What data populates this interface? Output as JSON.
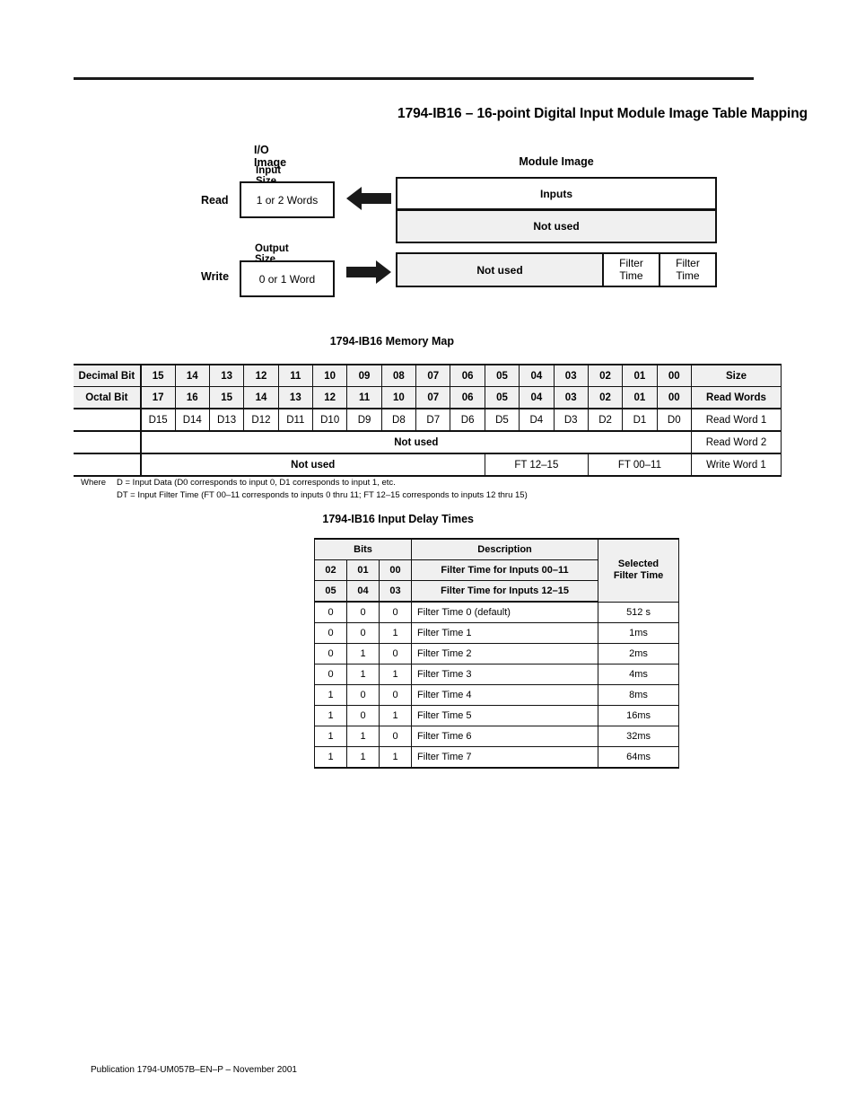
{
  "page": {
    "title": "1794-IB16 – 16-point Digital Input Module Image Table Mapping",
    "footer": "Publication 1794-UM057B–EN–P – November 2001"
  },
  "diagram": {
    "io_image_label": "I/O Image",
    "input_size_label": "Input Size",
    "output_size_label": "Output Size",
    "module_image_label": "Module Image",
    "read_label": "Read",
    "write_label": "Write",
    "input_size_value": "1 or 2 Words",
    "output_size_value": "0 or 1 Word",
    "read_arrow_icon": "arrow-left-icon",
    "write_arrow_icon": "arrow-right-icon",
    "module_inputs": "Inputs",
    "module_not_used_read": "Not used",
    "module_not_used_write": "Not used",
    "module_filter_time_1": "Filter\nTime",
    "module_filter_time_2": "Filter\nTime"
  },
  "memory_map": {
    "title": "1794-IB16 Memory Map",
    "row_decimal": {
      "label": "Decimal Bit",
      "bits": [
        "15",
        "14",
        "13",
        "12",
        "11",
        "10",
        "09",
        "08",
        "07",
        "06",
        "05",
        "04",
        "03",
        "02",
        "01",
        "00"
      ],
      "size": "Size"
    },
    "row_octal": {
      "label": "Octal Bit",
      "bits": [
        "17",
        "16",
        "15",
        "14",
        "13",
        "12",
        "11",
        "10",
        "07",
        "06",
        "05",
        "04",
        "03",
        "02",
        "01",
        "00"
      ],
      "size": "Read Words"
    },
    "row_read_word_1": {
      "label": "",
      "bits": [
        "D15",
        "D14",
        "D13",
        "D12",
        "D11",
        "D10",
        "D9",
        "D8",
        "D7",
        "D6",
        "D5",
        "D4",
        "D3",
        "D2",
        "D1",
        "D0"
      ],
      "size": "Read Word 1"
    },
    "row_read_word_2": {
      "label": "",
      "span_text": "Not used",
      "size": "Read Word 2"
    },
    "row_write_word_1": {
      "label": "",
      "not_used": "Not used",
      "ft_12_15": "FT 12–15",
      "ft_00_11": "FT 00–11",
      "size": "Write Word 1"
    },
    "where_label": "Where",
    "where_line_1": "D = Input Data (D0 corresponds to input 0, D1 corresponds to input 1, etc.",
    "where_line_2": "DT = Input Filter Time (FT 00–11 corresponds to inputs 0 thru 11; FT 12–15 corresponds to inputs 12 thru 15)"
  },
  "delay_times": {
    "title": "1794-IB16 Input Delay Times",
    "header_bits": "Bits",
    "header_description": "Description",
    "header_selected": "Selected\nFilter Time",
    "bit_row_1": {
      "bits": [
        "02",
        "01",
        "00"
      ],
      "description": "Filter Time for Inputs 00–11"
    },
    "bit_row_2": {
      "bits": [
        "05",
        "04",
        "03"
      ],
      "description": "Filter Time for Inputs 12–15"
    },
    "rows": [
      {
        "b2": "0",
        "b1": "0",
        "b0": "0",
        "description": "Filter Time 0 (default)",
        "value": "512  s"
      },
      {
        "b2": "0",
        "b1": "0",
        "b0": "1",
        "description": "Filter Time 1",
        "value": "1ms"
      },
      {
        "b2": "0",
        "b1": "1",
        "b0": "0",
        "description": "Filter Time 2",
        "value": "2ms"
      },
      {
        "b2": "0",
        "b1": "1",
        "b0": "1",
        "description": "Filter Time 3",
        "value": "4ms"
      },
      {
        "b2": "1",
        "b1": "0",
        "b0": "0",
        "description": "Filter Time 4",
        "value": "8ms"
      },
      {
        "b2": "1",
        "b1": "0",
        "b0": "1",
        "description": "Filter Time 5",
        "value": "16ms"
      },
      {
        "b2": "1",
        "b1": "1",
        "b0": "0",
        "description": "Filter Time 6",
        "value": "32ms"
      },
      {
        "b2": "1",
        "b1": "1",
        "b0": "1",
        "description": "Filter Time 7",
        "value": "64ms"
      }
    ]
  },
  "colors": {
    "ink": "#111111",
    "header_fill": "#f0f0f0",
    "page_bg": "#ffffff"
  }
}
